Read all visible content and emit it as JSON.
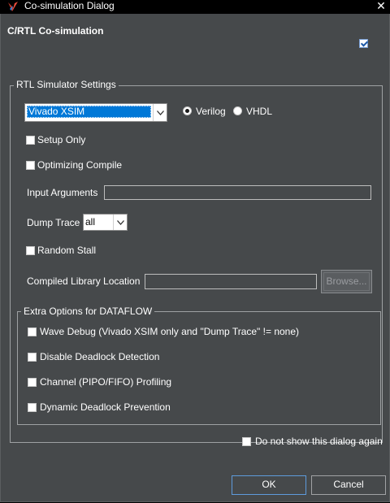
{
  "window": {
    "title": "Co-simulation Dialog",
    "close_glyph": "✕"
  },
  "header": {
    "title": "C/RTL Co-simulation",
    "checked": true
  },
  "simulator_group": {
    "legend": "RTL Simulator Settings",
    "simulator_select": {
      "value": "Vivado XSIM"
    },
    "language": {
      "options": [
        "Verilog",
        "VHDL"
      ],
      "selected": "Verilog"
    },
    "setup_only": {
      "label": "Setup Only",
      "checked": false
    },
    "optimizing_compile": {
      "label": "Optimizing Compile",
      "checked": false
    },
    "input_arguments": {
      "label": "Input Arguments",
      "value": ""
    },
    "dump_trace": {
      "label": "Dump Trace",
      "value": "all"
    },
    "random_stall": {
      "label": "Random Stall",
      "checked": false
    },
    "compiled_library": {
      "label": "Compiled Library Location",
      "value": "",
      "browse_label": "Browse..."
    }
  },
  "dataflow_group": {
    "legend": "Extra Options for DATAFLOW",
    "options": [
      {
        "label": "Wave Debug (Vivado XSIM only and \"Dump Trace\" != none)",
        "checked": false
      },
      {
        "label": "Disable Deadlock Detection",
        "checked": false
      },
      {
        "label": "Channel (PIPO/FIFO) Profiling",
        "checked": false
      },
      {
        "label": "Dynamic Deadlock Prevention",
        "checked": false
      }
    ]
  },
  "footer": {
    "dont_show": {
      "label": "Do not show this dialog again",
      "checked": false
    },
    "ok_label": "OK",
    "cancel_label": "Cancel"
  },
  "colors": {
    "background": "#46494b",
    "selection": "#0078d7",
    "title_bar": "#000000"
  }
}
